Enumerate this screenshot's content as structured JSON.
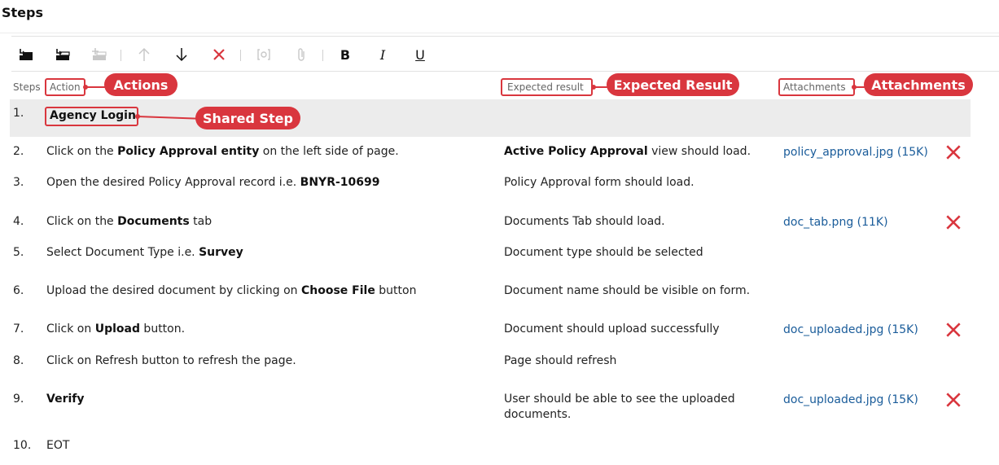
{
  "page": {
    "title": "Steps"
  },
  "toolbar": {
    "insert_step_icon": "insert-step-icon",
    "insert_shared_step_icon": "insert-shared-step-icon",
    "create_shared_step_icon": "create-shared-step-icon",
    "move_up_icon": "arrow-up-icon",
    "move_down_icon": "arrow-down-icon",
    "delete_icon": "close-icon",
    "parameter_icon": "parameter-icon",
    "attach_icon": "paperclip-icon",
    "bold_label": "B",
    "italic_label": "I",
    "underline_label": "U"
  },
  "columns": {
    "steps": "Steps",
    "action": "Action",
    "expected": "Expected result",
    "attachments": "Attachments"
  },
  "callouts": {
    "actions": "Actions",
    "expected": "Expected Result",
    "attachments": "Attachments",
    "shared_step": "Shared Step"
  },
  "colors": {
    "accent_red": "#d9363e",
    "link_blue": "#1a5c9a",
    "shared_row_bg": "#ececec"
  },
  "steps": [
    {
      "num": "1.",
      "action": "Agency Login"
    },
    {
      "num": "2.",
      "action_parts": [
        "Click on the ",
        "Policy Approval entity",
        " on the left side of page."
      ],
      "expected_parts": [
        "Active Policy Approval",
        " view should load."
      ],
      "attachment": "policy_approval.jpg (15K)"
    },
    {
      "num": "3.",
      "action_parts": [
        "Open the desired Policy Approval record i.e. ",
        "BNYR-10699"
      ],
      "expected": "Policy Approval form should load."
    },
    {
      "num": "4.",
      "action_parts": [
        "Click on the ",
        "Documents",
        " tab"
      ],
      "expected": "Documents Tab should load.",
      "attachment": "doc_tab.png (11K)"
    },
    {
      "num": "5.",
      "action_parts": [
        "Select Document Type i.e. ",
        "Survey"
      ],
      "expected": "Document type should be selected"
    },
    {
      "num": "6.",
      "action_parts": [
        "Upload the desired document by clicking on ",
        "Choose File",
        " button"
      ],
      "expected": "Document name should be visible on form."
    },
    {
      "num": "7.",
      "action_parts": [
        "Click on ",
        "Upload",
        " button."
      ],
      "expected": "Document should upload successfully",
      "attachment": "doc_uploaded.jpg (15K)"
    },
    {
      "num": "8.",
      "action": "Click on Refresh button to refresh the page.",
      "expected": "Page should refresh"
    },
    {
      "num": "9.",
      "action": "Verify",
      "expected": "User should be able to see the uploaded documents.",
      "attachment": "doc_uploaded.jpg (15K)"
    },
    {
      "num": "10.",
      "action": "EOT"
    }
  ]
}
